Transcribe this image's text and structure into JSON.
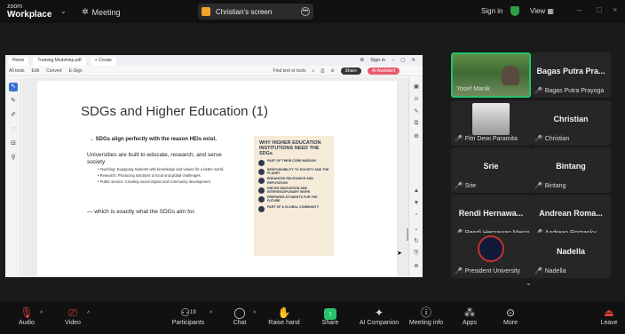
{
  "app": {
    "brand_line1": "zoom",
    "brand_line2": "Workplace",
    "meeting_label": "Meeting",
    "sign_in": "Sign in",
    "view": "View"
  },
  "share_banner": {
    "label": "Christian's screen"
  },
  "browser": {
    "tabs": [
      "Home",
      "Training Modelekp.pdf",
      "+ Create"
    ],
    "window_sign_in": "Sign in",
    "menu": [
      "All tools",
      "Edit",
      "Convert",
      "E-Sign"
    ],
    "find_text": "Find text or tools",
    "share_btn": "Share",
    "ai_btn": "AI Assistant"
  },
  "slide": {
    "title": "SDGs and Higher Education (1)",
    "bullet_main": "→ SDGs align perfectly with the reason HEIs exist.",
    "univ_line": "Universities are built to educate, research, and serve society",
    "items": [
      "Teaching: Equipping students with knowledge and values for a better world.",
      "Research: Producing solutions to local and global challenges.",
      "Public service: Creating social impact and community development."
    ],
    "which": "— which is exactly what the SDGs aim for."
  },
  "infographic": {
    "title": "WHY HIGHER EDUCATION INSTITUTIONS NEED THE SDGs",
    "rows": [
      "PART OF THEIR CORE MISSION",
      "RESPONSIBILITY TO SOCIETY AND THE PLANET",
      "ENHANCED RELEVANCE AND REPUTATION",
      "DRIVES INNOVATION AND INTERDISCIPLINARY WORK",
      "PREPARES STUDENTS FOR THE FUTURE",
      "PART OF A GLOBAL COMMUNITY"
    ]
  },
  "participants": [
    {
      "big": "",
      "name": "Yosef Manik",
      "muted": false,
      "video": true
    },
    {
      "big": "Bagas Putra Pra...",
      "name": "Bagas Putra Prayoga",
      "muted": true
    },
    {
      "big": "",
      "name": "Fitri Dewi Paramita",
      "muted": true,
      "photo": true
    },
    {
      "big": "Christian",
      "name": "Christian",
      "muted": true
    },
    {
      "big": "Srie",
      "name": "Srie",
      "muted": true
    },
    {
      "big": "Bintang",
      "name": "Bintang",
      "muted": true
    },
    {
      "big": "Rendi Hernawa...",
      "name": "Rendi Hernawan Mesin",
      "muted": true
    },
    {
      "big": "Andrean Roma...",
      "name": "Andrean Romanky",
      "muted": true
    },
    {
      "big": "",
      "name": "President University",
      "muted": true,
      "emblem": true
    },
    {
      "big": "Nadella",
      "name": "Nadella",
      "muted": true
    }
  ],
  "toolbar": {
    "audio": "Audio",
    "video": "Video",
    "participants": "Participants",
    "participants_count": "19",
    "chat": "Chat",
    "raise_hand": "Raise hand",
    "share": "Share",
    "ai_companion": "AI Companion",
    "meeting_info": "Meeting info",
    "apps": "Apps",
    "more": "More",
    "leave": "Leave"
  }
}
